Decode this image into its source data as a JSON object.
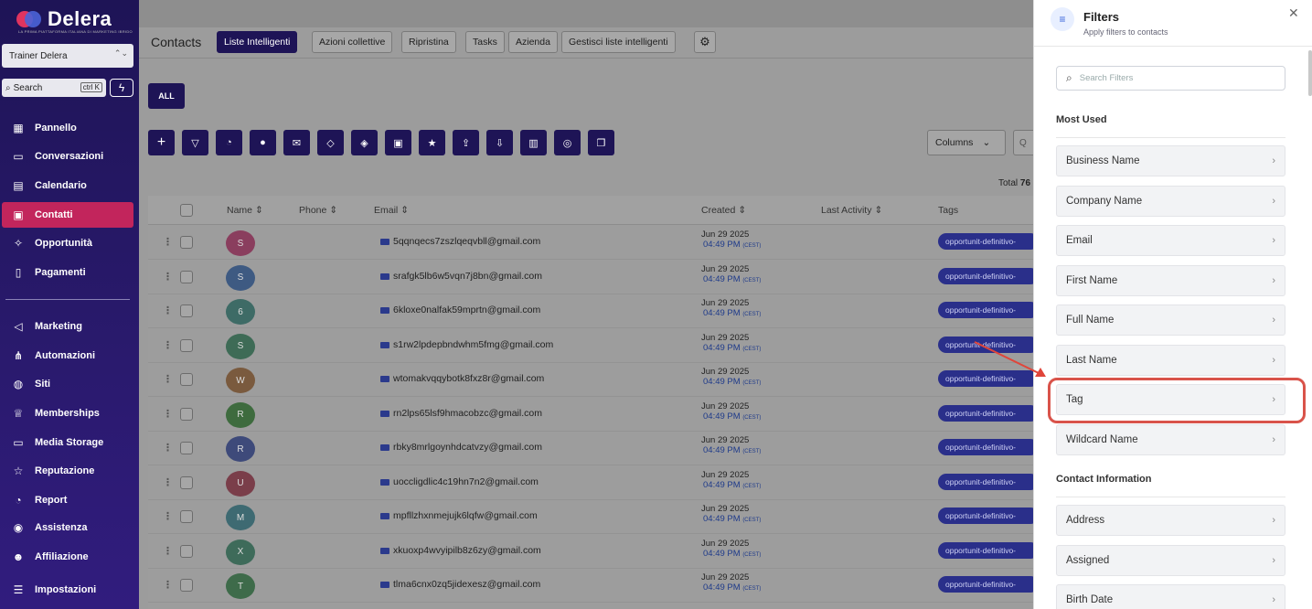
{
  "brand": {
    "name": "Delera",
    "tagline": "LA PRIMA PIATTAFORMA ITALIANA DI MARKETING IBRIDO"
  },
  "account": {
    "selected": "Trainer Delera"
  },
  "search": {
    "label": "Search",
    "shortcut": "ctrl K"
  },
  "sidebar": {
    "items": [
      {
        "label": "Pannello",
        "icon": "dashboard-icon",
        "glyph": "▦"
      },
      {
        "label": "Conversazioni",
        "icon": "chat-icon",
        "glyph": "▭"
      },
      {
        "label": "Calendario",
        "icon": "calendar-icon",
        "glyph": "▤"
      },
      {
        "label": "Contatti",
        "icon": "contacts-icon",
        "glyph": "▣",
        "active": true
      },
      {
        "label": "Opportunità",
        "icon": "opportunity-icon",
        "glyph": "✧"
      },
      {
        "label": "Pagamenti",
        "icon": "payments-icon",
        "glyph": "▯"
      },
      {
        "label": "Marketing",
        "icon": "megaphone-icon",
        "glyph": "◁"
      },
      {
        "label": "Automazioni",
        "icon": "automation-icon",
        "glyph": "⋔"
      },
      {
        "label": "Siti",
        "icon": "globe-icon",
        "glyph": "◍"
      },
      {
        "label": "Memberships",
        "icon": "crown-icon",
        "glyph": "♕"
      },
      {
        "label": "Media Storage",
        "icon": "storage-icon",
        "glyph": "▭"
      },
      {
        "label": "Reputazione",
        "icon": "star-icon",
        "glyph": "☆"
      },
      {
        "label": "Report",
        "icon": "report-icon",
        "glyph": "◔"
      },
      {
        "label": "Assistenza",
        "icon": "support-icon",
        "glyph": "◉"
      },
      {
        "label": "Affiliazione",
        "icon": "affiliate-icon",
        "glyph": "☻"
      },
      {
        "label": "Impostazioni",
        "icon": "settings-icon",
        "glyph": "☰"
      }
    ]
  },
  "header": {
    "title": "Contacts",
    "tabs": [
      "Liste Intelligenti",
      "Azioni collettive",
      "Ripristina",
      "Tasks",
      "Azienda",
      "Gestisci liste intelligenti"
    ]
  },
  "toolbar": {
    "all_label": "ALL",
    "actions": [
      "add-icon",
      "filter-icon",
      "pipeline-icon",
      "sms-icon",
      "email-icon",
      "add-tag-icon",
      "remove-tag-icon",
      "delete-icon",
      "star-icon",
      "export-icon",
      "import-icon",
      "merge-icon",
      "whatsapp-icon",
      "copy-icon"
    ],
    "columns_label": "Columns",
    "search_placeholder": "Q"
  },
  "table": {
    "total_label": "Total",
    "total_value": "76",
    "headers": {
      "name": "Name",
      "phone": "Phone",
      "email": "Email",
      "created": "Created",
      "last_activity": "Last Activity",
      "tags": "Tags"
    },
    "rows": [
      {
        "initial": "S",
        "color": "#8a3e5e",
        "email": "5qqnqecs7zszlqeqvbll@gmail.com",
        "date": "Jun 29 2025",
        "time": "04:49 PM",
        "tz": "(CEST)",
        "tag": "opportunit-definitivo-"
      },
      {
        "initial": "S",
        "color": "#3e5a82",
        "email": "srafgk5lb6w5vqn7j8bn@gmail.com",
        "date": "Jun 29 2025",
        "time": "04:49 PM",
        "tz": "(CEST)",
        "tag": "opportunit-definitivo-"
      },
      {
        "initial": "6",
        "color": "#3e6b66",
        "email": "6kloxe0nalfak59mprtn@gmail.com",
        "date": "Jun 29 2025",
        "time": "04:49 PM",
        "tz": "(CEST)",
        "tag": "opportunit-definitivo-"
      },
      {
        "initial": "S",
        "color": "#3e6b56",
        "email": "s1rw2lpdepbndwhm5fmg@gmail.com",
        "date": "Jun 29 2025",
        "time": "04:49 PM",
        "tz": "(CEST)",
        "tag": "opportunit-definitivo-"
      },
      {
        "initial": "W",
        "color": "#7a5a3e",
        "email": "wtomakvqqybotk8fxz8r@gmail.com",
        "date": "Jun 29 2025",
        "time": "04:49 PM",
        "tz": "(CEST)",
        "tag": "opportunit-definitivo-"
      },
      {
        "initial": "R",
        "color": "#3e6b3e",
        "email": "rn2lps65lsf9hmacobzc@gmail.com",
        "date": "Jun 29 2025",
        "time": "04:49 PM",
        "tz": "(CEST)",
        "tag": "opportunit-definitivo-"
      },
      {
        "initial": "R",
        "color": "#3e4a7a",
        "email": "rbky8mrlgoynhdcatvzy@gmail.com",
        "date": "Jun 29 2025",
        "time": "04:49 PM",
        "tz": "(CEST)",
        "tag": "opportunit-definitivo-"
      },
      {
        "initial": "U",
        "color": "#7a3e4a",
        "email": "uoccligdlic4c19hn7n2@gmail.com",
        "date": "Jun 29 2025",
        "time": "04:49 PM",
        "tz": "(CEST)",
        "tag": "opportunit-definitivo-"
      },
      {
        "initial": "M",
        "color": "#3e6a72",
        "email": "mpfllzhxnmejujk6lqfw@gmail.com",
        "date": "Jun 29 2025",
        "time": "04:49 PM",
        "tz": "(CEST)",
        "tag": "opportunit-definitivo-"
      },
      {
        "initial": "X",
        "color": "#3e6b5a",
        "email": "xkuoxp4wvyipilb8z6zy@gmail.com",
        "date": "Jun 29 2025",
        "time": "04:49 PM",
        "tz": "(CEST)",
        "tag": "opportunit-definitivo-"
      },
      {
        "initial": "T",
        "color": "#3e6b4a",
        "email": "tlma6cnx0zq5jidexesz@gmail.com",
        "date": "Jun 29 2025",
        "time": "04:49 PM",
        "tz": "(CEST)",
        "tag": "opportunit-definitivo-"
      }
    ]
  },
  "filters_panel": {
    "title": "Filters",
    "subtitle": "Apply filters to contacts",
    "search_placeholder": "Search Filters",
    "sections": [
      {
        "title": "Most Used",
        "items": [
          "Business Name",
          "Company Name",
          "Email",
          "First Name",
          "Full Name",
          "Last Name",
          "Tag",
          "Wildcard Name"
        ]
      },
      {
        "title": "Contact Information",
        "items": [
          "Address",
          "Assigned",
          "Birth Date"
        ]
      }
    ],
    "highlighted_item": "Tag",
    "highlight_color": "#d9534a"
  }
}
